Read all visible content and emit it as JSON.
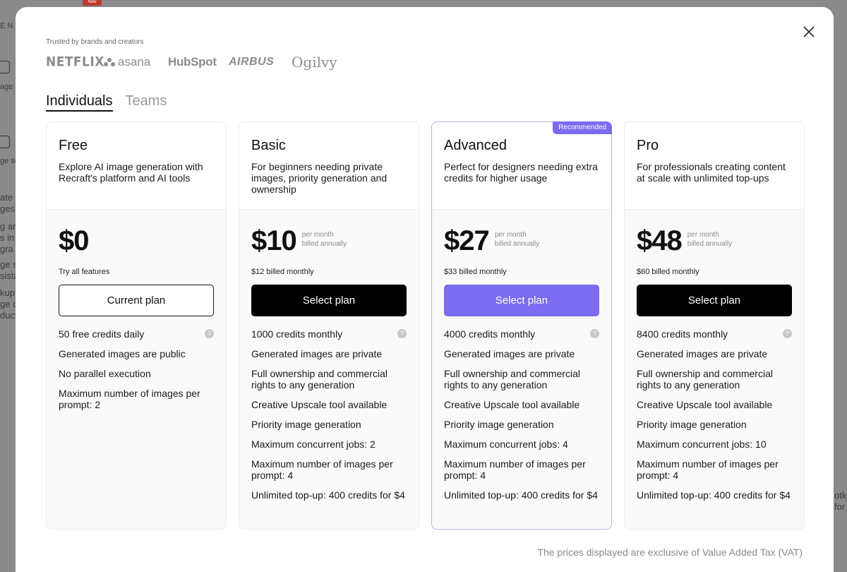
{
  "background": {
    "new_badge": "New",
    "texts": [
      "E N",
      "age",
      "ge se",
      "ate c",
      "ges",
      "g an",
      "s in",
      "gra",
      "ge s",
      "sista",
      "kup",
      "ge c",
      "duct",
      "otke",
      "for"
    ]
  },
  "modal": {
    "close_icon": "close-icon",
    "trusted_label": "Trusted by brands and creators",
    "logos": [
      "NETFLIX",
      "asana",
      "HubSpot",
      "AIRBUS",
      "Ogilvy"
    ],
    "tabs": [
      {
        "label": "Individuals",
        "active": true
      },
      {
        "label": "Teams",
        "active": false
      }
    ],
    "plans": [
      {
        "name": "Free",
        "description": "Explore AI image generation with Recraft's platform and AI tools",
        "price": "$0",
        "price_note_1": "",
        "price_note_2": "",
        "billed": "Try all features",
        "button": "Current plan",
        "features": [
          "50 free credits daily",
          "Generated images are public",
          "No parallel execution",
          "Maximum number of images per prompt: 2"
        ]
      },
      {
        "name": "Basic",
        "description": "For beginners needing private images, priority generation and ownership",
        "price": "$10",
        "price_note_1": "per month",
        "price_note_2": "billed annually",
        "billed": "$12 billed monthly",
        "button": "Select plan",
        "features": [
          "1000 credits monthly",
          "Generated images are private",
          "Full ownership and commercial rights to any generation",
          "Creative Upscale tool available",
          "Priority image generation",
          "Maximum concurrent jobs: 2",
          "Maximum number of images per prompt: 4",
          "Unlimited top-up: 400 credits for $4"
        ]
      },
      {
        "name": "Advanced",
        "badge": "Recommended",
        "description": "Perfect for designers needing extra credits for higher usage",
        "price": "$27",
        "price_note_1": "per month",
        "price_note_2": "billed annually",
        "billed": "$33 billed monthly",
        "button": "Select plan",
        "features": [
          "4000 credits monthly",
          "Generated images are private",
          "Full ownership and commercial rights to any generation",
          "Creative Upscale tool available",
          "Priority image generation",
          "Maximum concurrent jobs: 4",
          "Maximum number of images per prompt: 4",
          "Unlimited top-up: 400 credits for $4"
        ]
      },
      {
        "name": "Pro",
        "description": "For professionals creating content at scale with unlimited top-ups",
        "price": "$48",
        "price_note_1": "per month",
        "price_note_2": "billed annually",
        "billed": "$60 billed monthly",
        "button": "Select plan",
        "features": [
          "8400 credits monthly",
          "Generated images are private",
          "Full ownership and commercial rights to any generation",
          "Creative Upscale tool available",
          "Priority image generation",
          "Maximum concurrent jobs: 10",
          "Maximum number of images per prompt: 4",
          "Unlimited top-up: 400 credits for $4"
        ]
      }
    ],
    "help_icon_glyph": "?",
    "vat_note": "The prices displayed are exclusive of Value Added Tax (VAT)"
  },
  "colors": {
    "accent": "#7b6cf0",
    "overlay": "#8a8a8a"
  }
}
